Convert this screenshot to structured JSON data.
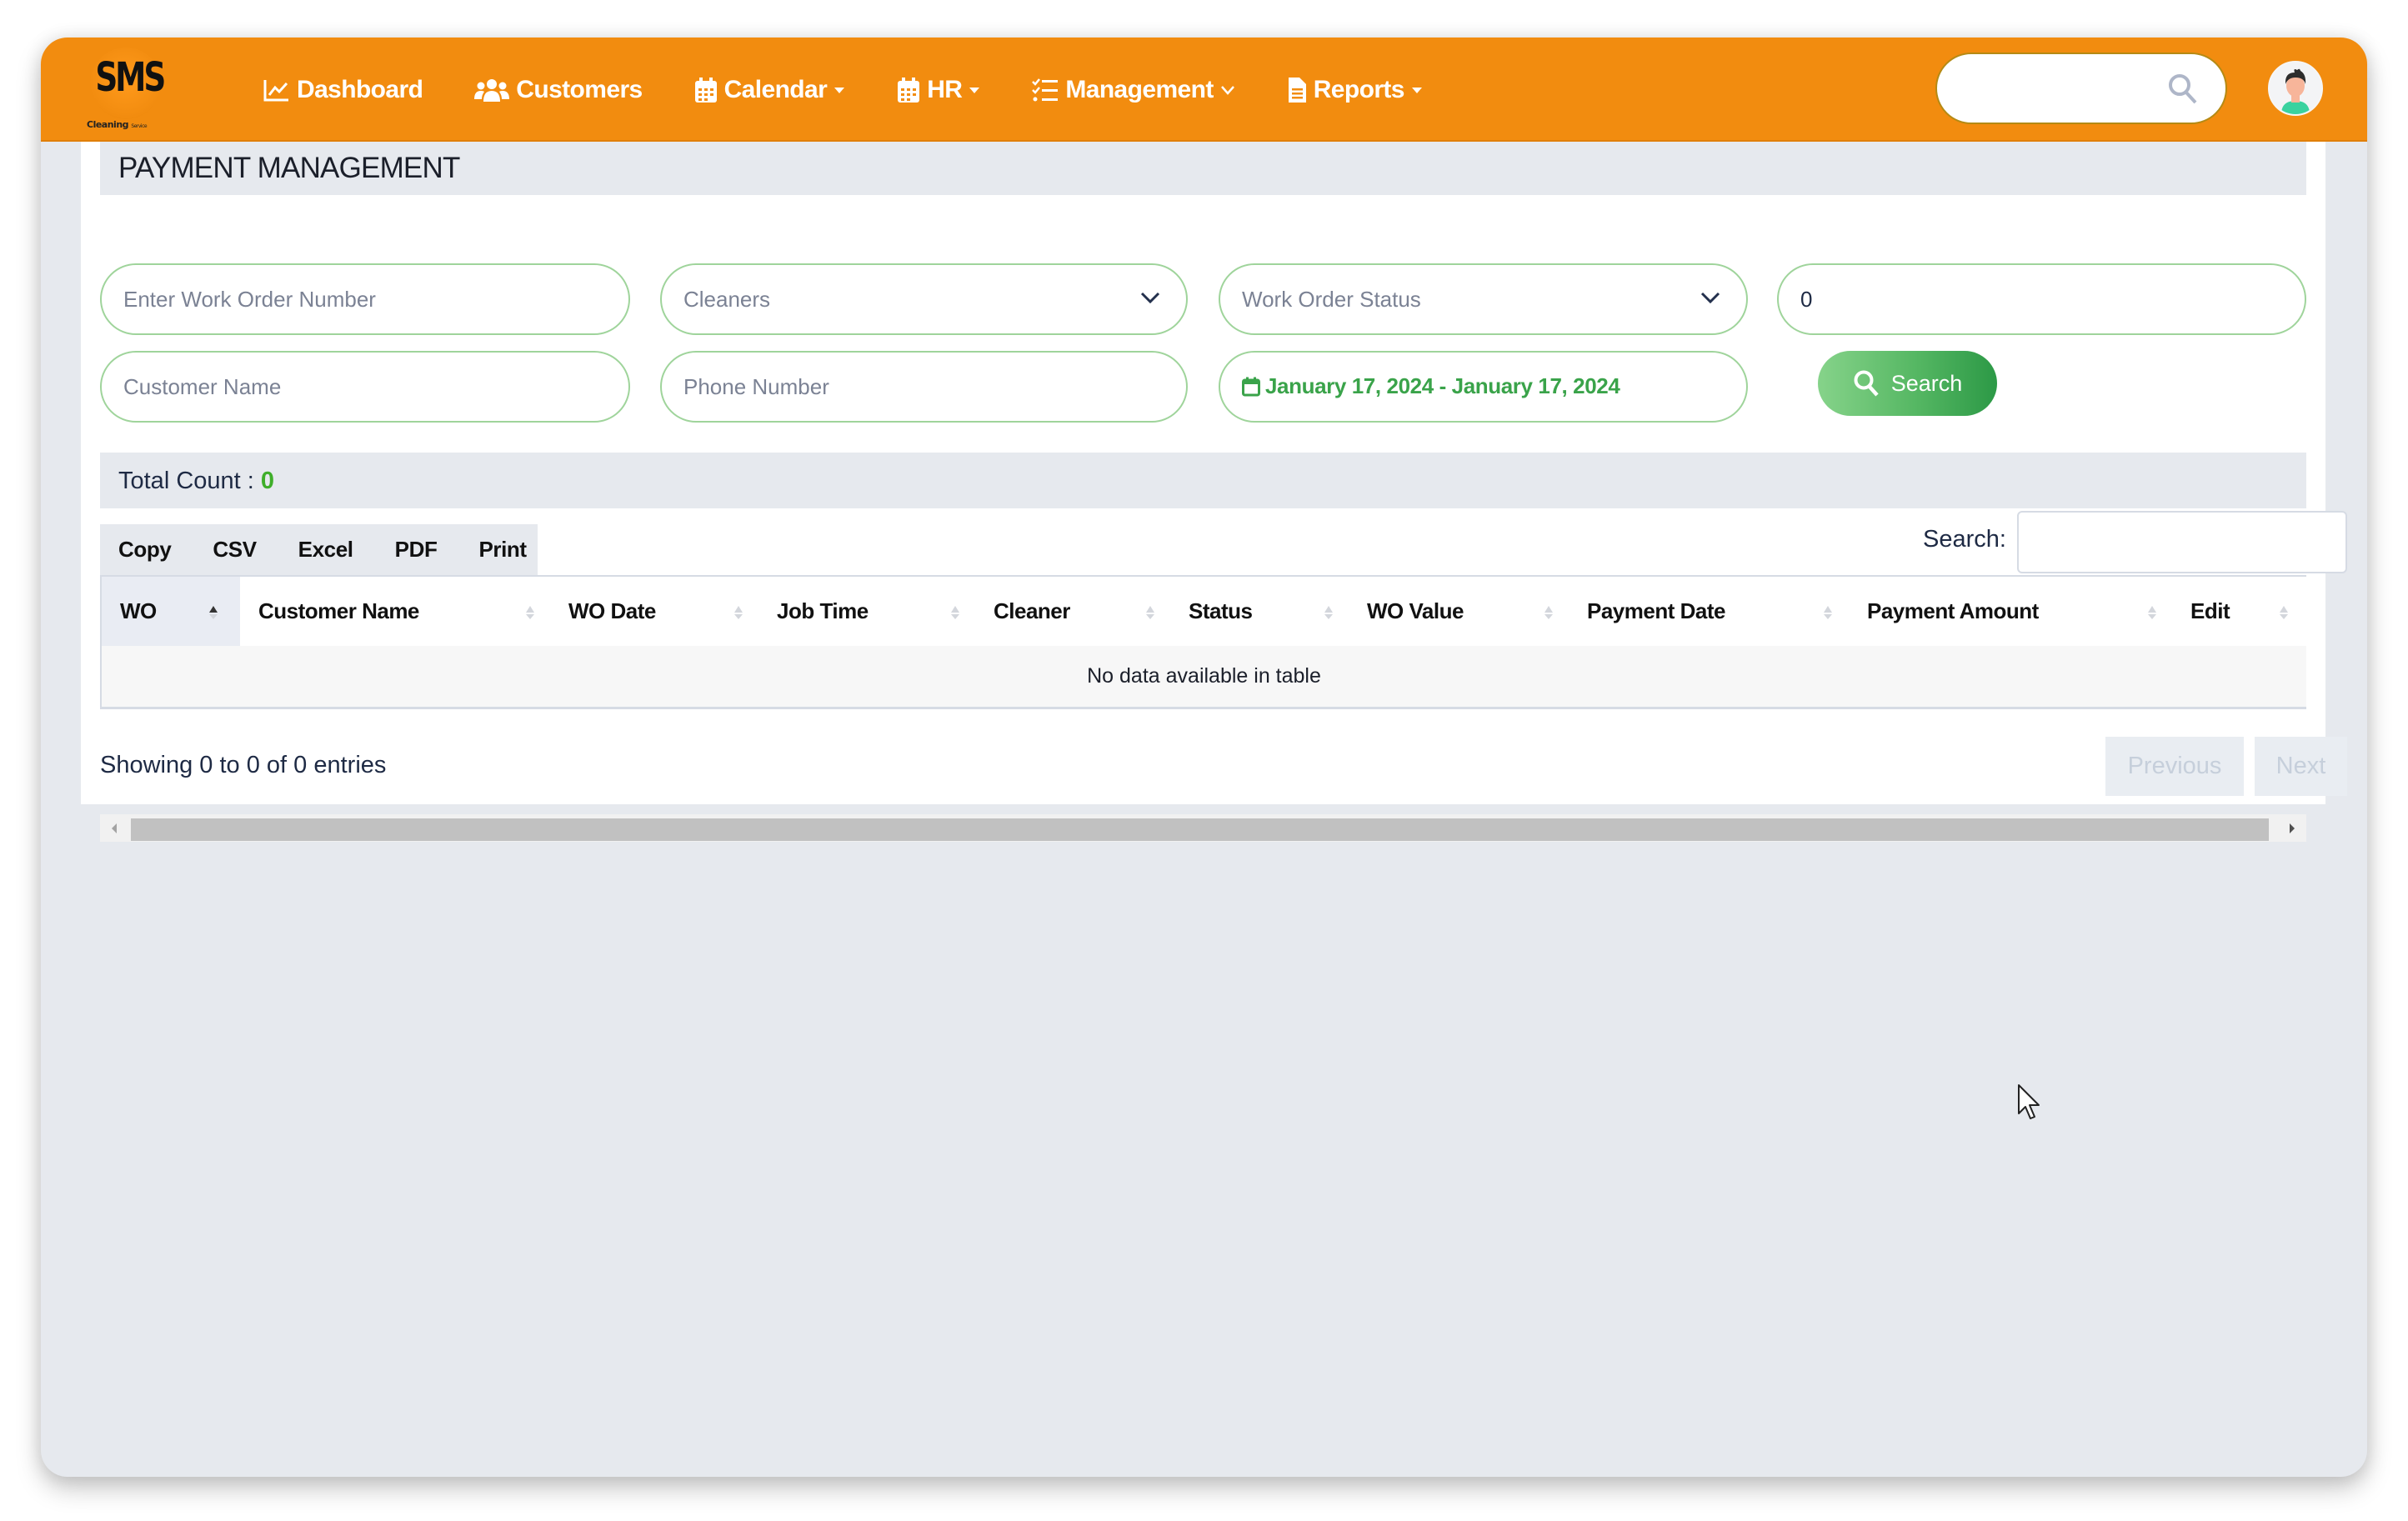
{
  "app": {
    "logo_text": "SMS",
    "logo_tagline": "Cleaning",
    "logo_tagline_small": "Service"
  },
  "nav": {
    "items": [
      {
        "label": "Dashboard",
        "icon": "chart-line-icon",
        "dropdown": false
      },
      {
        "label": "Customers",
        "icon": "users-icon",
        "dropdown": false
      },
      {
        "label": "Calendar",
        "icon": "calendar-icon",
        "dropdown": true
      },
      {
        "label": "HR",
        "icon": "calendar-icon",
        "dropdown": true
      },
      {
        "label": "Management",
        "icon": "list-check-icon",
        "dropdown": true
      },
      {
        "label": "Reports",
        "icon": "file-icon",
        "dropdown": true
      }
    ],
    "search_placeholder": ""
  },
  "page": {
    "title": "PAYMENT MANAGEMENT"
  },
  "filters": {
    "work_order_placeholder": "Enter Work Order Number",
    "cleaners_selected": "Cleaners",
    "work_order_status_selected": "Work Order Status",
    "amount_value": "0",
    "customer_name_placeholder": "Customer Name",
    "phone_placeholder": "Phone Number",
    "date_range": "January 17, 2024 - January 17, 2024",
    "search_label": "Search"
  },
  "summary": {
    "total_count_label": "Total Count : ",
    "total_count_value": "0"
  },
  "table": {
    "export_buttons": [
      "Copy",
      "CSV",
      "Excel",
      "PDF",
      "Print"
    ],
    "search_label": "Search:",
    "search_value": "",
    "columns": [
      "WO",
      "Customer Name",
      "WO Date",
      "Job Time",
      "Cleaner",
      "Status",
      "WO Value",
      "Payment Date",
      "Payment Amount",
      "Edit"
    ],
    "sorted_column": "WO",
    "sort_direction": "ascending",
    "empty_message": "No data available in table",
    "info": "Showing 0 to 0 of 0 entries",
    "pagination": {
      "previous": "Previous",
      "next": "Next"
    }
  },
  "colors": {
    "header": "#f28c0f",
    "accent_green": "#3fae2a",
    "input_border": "#9fd49b",
    "panel_bg": "#e6e9ee"
  }
}
